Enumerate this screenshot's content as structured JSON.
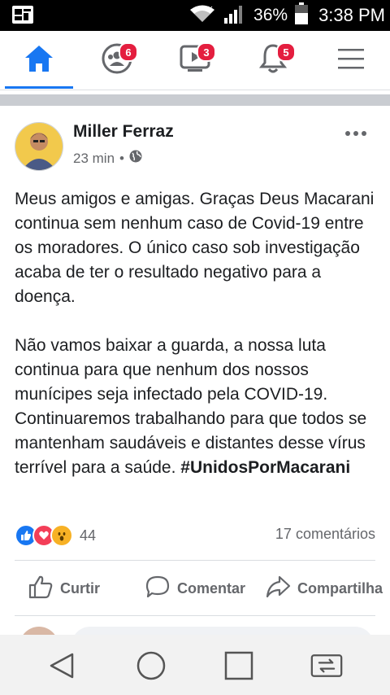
{
  "status_bar": {
    "battery_percent": "36%",
    "time": "3:38 PM",
    "icons": [
      "notification-app-icon",
      "wifi-icon",
      "signal-icon",
      "battery-icon"
    ]
  },
  "nav": {
    "items": [
      {
        "icon": "home-icon",
        "active": true
      },
      {
        "icon": "friends-icon",
        "badge": "6"
      },
      {
        "icon": "watch-icon",
        "badge": "3"
      },
      {
        "icon": "notifications-icon",
        "badge": "5"
      },
      {
        "icon": "menu-icon"
      }
    ]
  },
  "post": {
    "author": "Miller Ferraz",
    "time": "23 min",
    "separator": "•",
    "privacy_icon": "globe-icon",
    "paragraph1": "Meus amigos e amigas. Graças Deus Macarani continua sem nenhum caso de Covid-19 entre os moradores. O único caso sob investigação acaba de ter o resultado negativo para a doença.",
    "paragraph2": "Não vamos baixar a guarda, a nossa luta continua para que nenhum dos nossos munícipes seja infectado pela COVID-19. Continuaremos trabalhando para que todos se mantenham saudáveis e distantes desse vírus terrível para a saúde.",
    "hashtag": "#UnidosPorMacarani",
    "reaction_count": "44",
    "comments_count": "17 comentários",
    "actions": {
      "like": "Curtir",
      "comment": "Comentar",
      "share": "Compartilha"
    }
  },
  "colors": {
    "fb_blue": "#1877f2",
    "badge_red": "#e41e3f",
    "love_red": "#f33e58",
    "wow_yellow": "#f7b125"
  }
}
